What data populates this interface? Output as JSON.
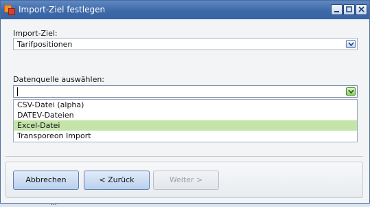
{
  "window": {
    "title": "Import-Ziel festlegen"
  },
  "import_target": {
    "label": "Import-Ziel:",
    "value": "Tarifpositionen"
  },
  "datasource": {
    "label": "Datenquelle auswählen:",
    "value": "",
    "options": [
      "CSV-Datei (alpha)",
      "DATEV-Dateien",
      "Excel-Datei",
      "Transporeon Import"
    ],
    "highlighted": "Excel-Datei"
  },
  "buttons": {
    "cancel": "Abbrechen",
    "back": "< Zurück",
    "next": "Weiter >"
  },
  "background_text": "...",
  "colors": {
    "title_bar": "#3e69a8",
    "highlight": "#c4e4a8",
    "button": "#b9d0ee"
  }
}
